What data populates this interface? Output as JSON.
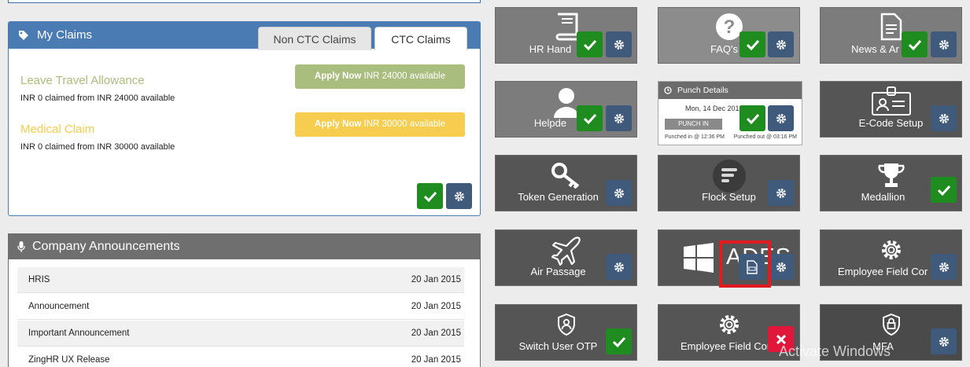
{
  "claims": {
    "title": "My Claims",
    "tabs": [
      {
        "label": "Non CTC Claims"
      },
      {
        "label": "CTC Claims"
      }
    ],
    "items": [
      {
        "name": "Leave Travel Allowance",
        "detail": "INR 0 claimed from INR 24000 available",
        "apply_strong": "Apply Now",
        "apply_rest": " INR 24000 available",
        "color": "#a9be7e"
      },
      {
        "name": "Medical Claim",
        "detail": "INR 0 claimed from INR 30000 available",
        "apply_strong": "Apply Now",
        "apply_rest": " INR 30000 available",
        "color": "#f6cd4e"
      }
    ]
  },
  "announcements": {
    "title": "Company Announcements",
    "rows": [
      {
        "title": "HRIS",
        "date": "20 Jan 2015"
      },
      {
        "title": "Announcement",
        "date": "20 Jan 2015"
      },
      {
        "title": "Important Announcement",
        "date": "20 Jan 2015"
      },
      {
        "title": "ZingHR UX Release",
        "date": "20 Jan 2015"
      }
    ]
  },
  "tiles": {
    "hr_handbook": "HR Hand",
    "faqs": "FAQ's",
    "news": "News & Ar",
    "helpdesk": "Helpde",
    "ecode": "E-Code Setup",
    "token": "Token Generation",
    "flock": "Flock Setup",
    "medallion": "Medallion",
    "air_passage": "Air Passage",
    "ades": "ADES",
    "employee_field_1": "Employee Field Cor",
    "switch_user_otp": "Switch User OTP",
    "employee_field_2": "Employee Field Cor",
    "mfa": "MFA"
  },
  "punch": {
    "title": "Punch Details",
    "date": "Mon, 14 Dec 2015",
    "punch_in_label": "PUNCH IN",
    "punched_in": "Punched in @ 12:36 PM",
    "punched_out": "Punched out @ 03:16 PM"
  },
  "watermark": "Activate Windows",
  "colors": {
    "accent_blue": "#4b7bb3",
    "green": "#1f8c1f",
    "cog_blue": "#3f5a7b",
    "red": "#e0173b"
  }
}
